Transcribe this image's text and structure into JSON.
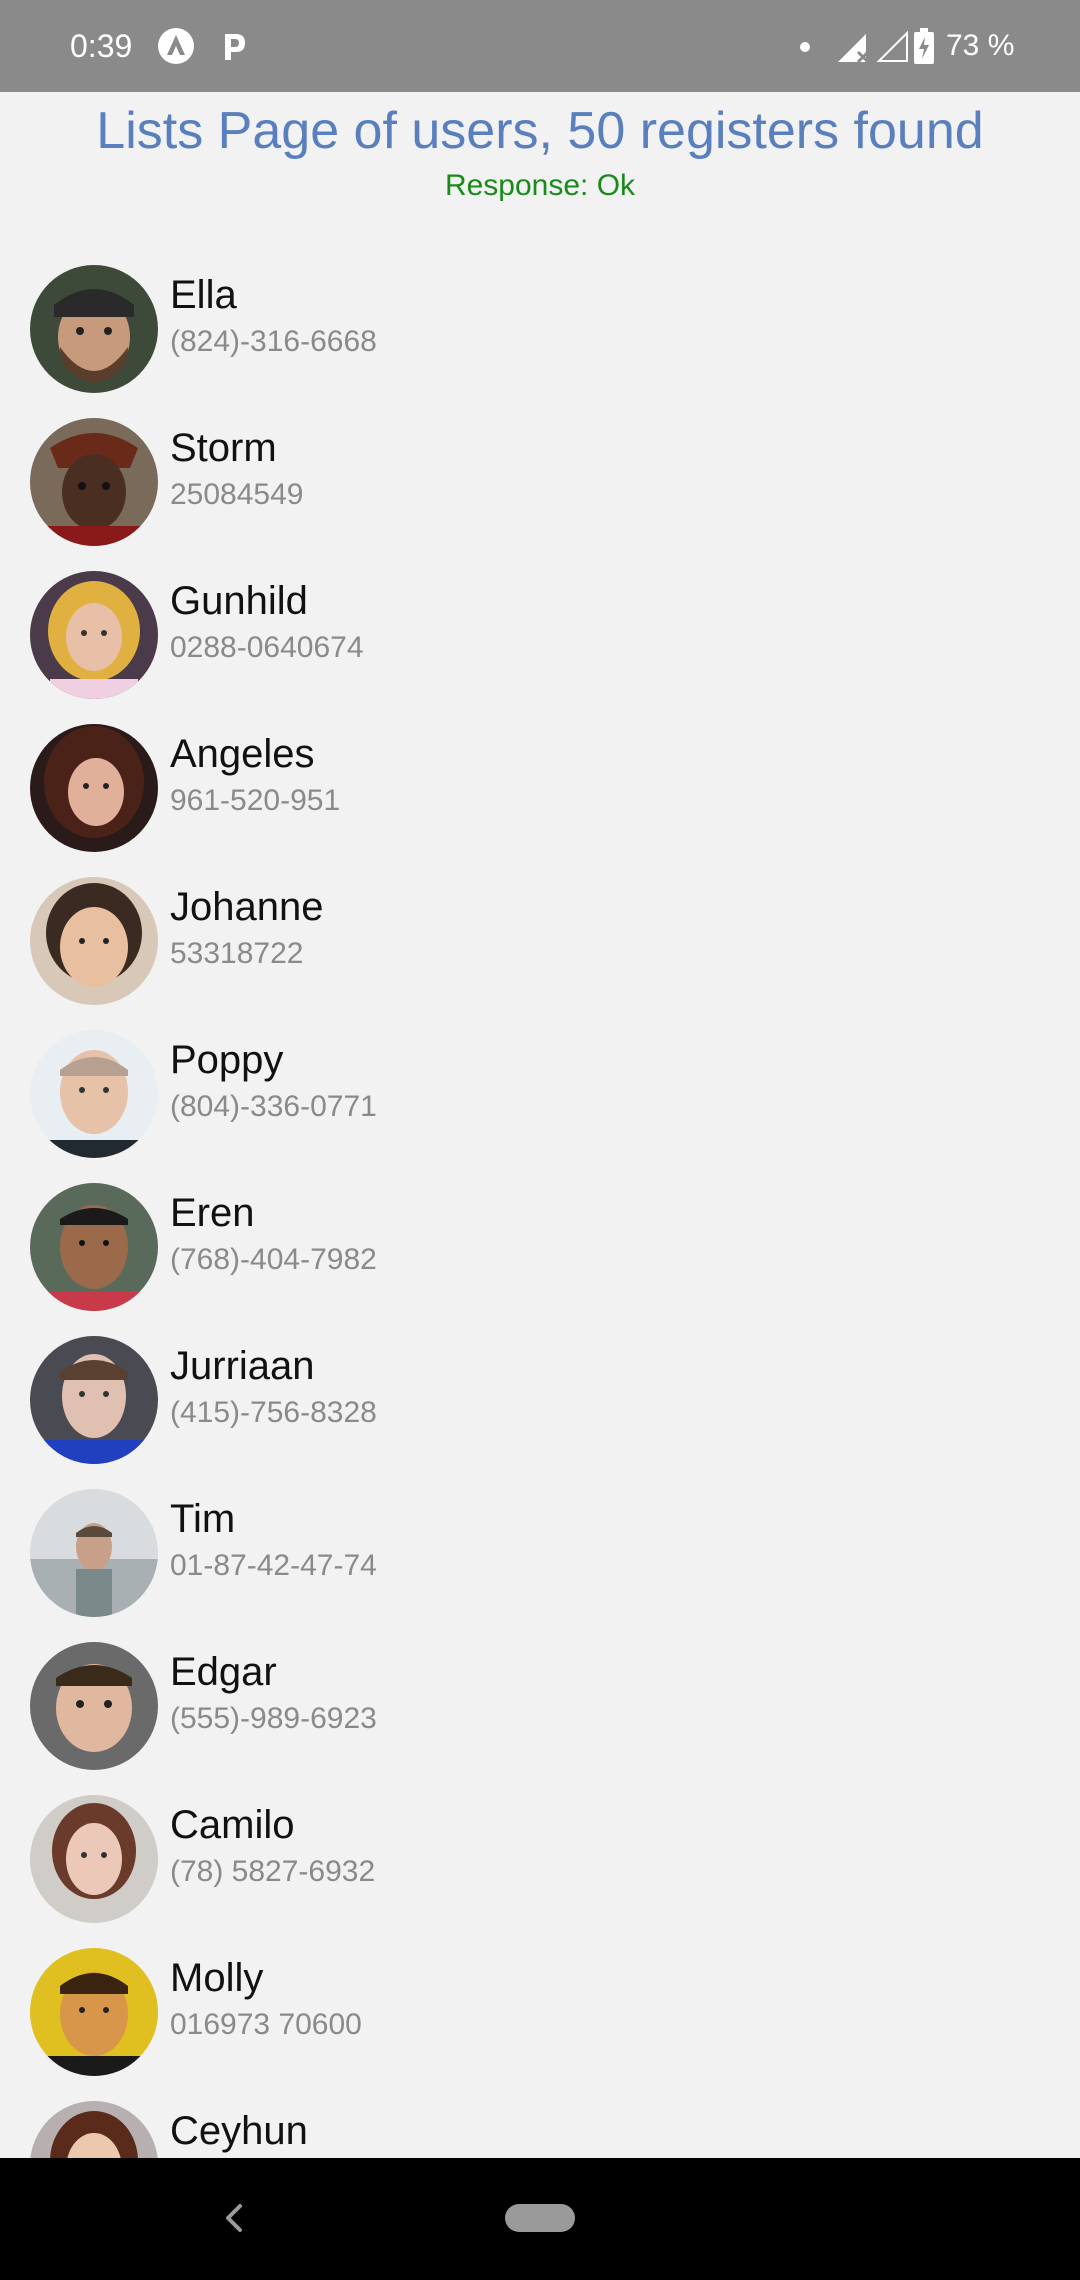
{
  "status_bar": {
    "time": "0:39",
    "battery": "73 %",
    "icons": [
      "arrow-app-icon",
      "parking-app-icon",
      "notification-dot-icon",
      "cell-signal-icon",
      "wifi-signal-icon",
      "battery-charging-icon"
    ]
  },
  "header": {
    "title": "Lists Page of users, 50 registers found",
    "response": "Response: Ok",
    "title_color": "#5a7fbf",
    "response_color": "#1a8a1a"
  },
  "users": [
    {
      "name": "Ella",
      "phone": "(824)-316-6668"
    },
    {
      "name": "Storm",
      "phone": "25084549"
    },
    {
      "name": "Gunhild",
      "phone": "0288-0640674"
    },
    {
      "name": "Angeles",
      "phone": "961-520-951"
    },
    {
      "name": "Johanne",
      "phone": "53318722"
    },
    {
      "name": "Poppy",
      "phone": "(804)-336-0771"
    },
    {
      "name": "Eren",
      "phone": "(768)-404-7982"
    },
    {
      "name": "Jurriaan",
      "phone": "(415)-756-8328"
    },
    {
      "name": "Tim",
      "phone": "01-87-42-47-74"
    },
    {
      "name": "Edgar",
      "phone": "(555)-989-6923"
    },
    {
      "name": "Camilo",
      "phone": "(78) 5827-6932"
    },
    {
      "name": "Molly",
      "phone": "016973 70600"
    },
    {
      "name": "Ceyhun",
      "phone": ""
    }
  ],
  "nav_bar": {
    "icons": [
      "back-icon",
      "home-pill-icon"
    ]
  }
}
